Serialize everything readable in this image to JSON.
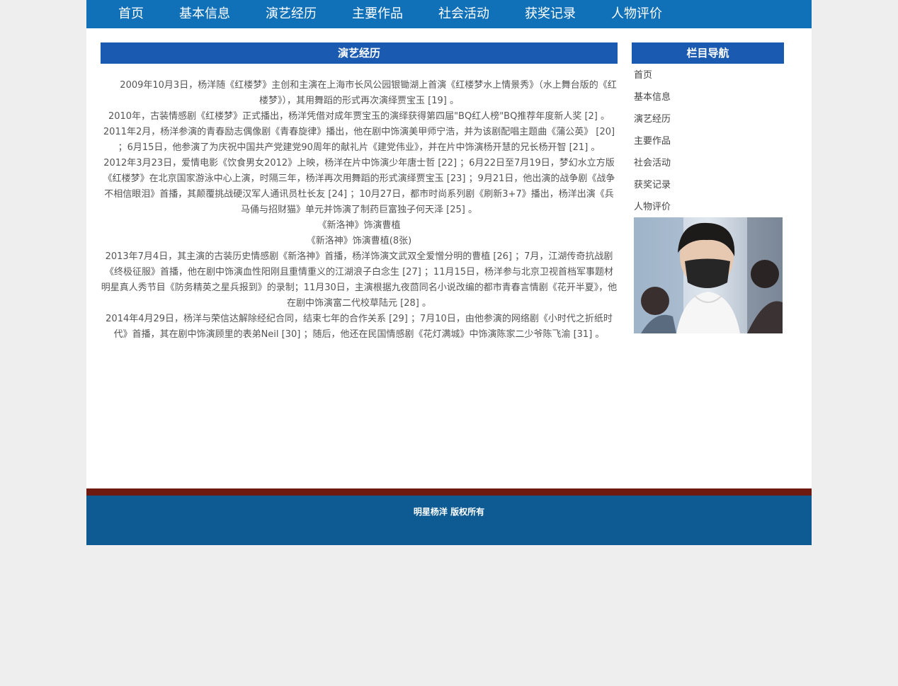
{
  "nav": {
    "items": [
      "首页",
      "基本信息",
      "演艺经历",
      "主要作品",
      "社会活动",
      "获奖记录",
      "人物评价"
    ]
  },
  "main": {
    "title": "演艺经历",
    "paragraphs": [
      "　　2009年10月3日，杨洋随《红楼梦》主创和主演在上海市长风公园银锄湖上首演《红楼梦水上情景秀》（水上舞台版的《红楼梦》），其用舞蹈的形式再次演绎贾宝玉 [19] 。",
      "2010年，古装情感剧《红楼梦》正式播出，杨洋凭借对成年贾宝玉的演绎获得第四届\"BQ红人榜\"BQ推荐年度新人奖 [2] 。",
      "2011年2月，杨洋参演的青春励志偶像剧《青春旋律》播出，他在剧中饰演美甲师宁浩，并为该剧配唱主题曲《蒲公英》 [20] ；6月15日，他参演了为庆祝中国共产党建党90周年的献礼片《建党伟业》，并在片中饰演杨开慧的兄长杨开智 [21] 。",
      "2012年3月23日，爱情电影《饮食男女2012》上映，杨洋在片中饰演少年唐士哲 [22] ；6月22日至7月19日，梦幻水立方版《红楼梦》在北京国家游泳中心上演，时隔三年，杨洋再次用舞蹈的形式演绎贾宝玉 [23] ；9月21日，他出演的战争剧《战争不相信眼泪》首播，其颠覆挑战硬汉军人通讯员杜长友 [24] ；10月27日，都市时尚系列剧《刷新3+7》播出，杨洋出演《兵马俑与招财猫》单元并饰演了制药巨富独子何天泽 [25] 。",
      "《新洛神》饰演曹植",
      "《新洛神》饰演曹植(8张)",
      "2013年7月4日，其主演的古装历史情感剧《新洛神》首播，杨洋饰演文武双全爱憎分明的曹植 [26] ；7月，江湖传奇抗战剧《终极征服》首播，他在剧中饰演血性阳刚且重情重义的江湖浪子白念生 [27] ；11月15日，杨洋参与北京卫视首档军事题材明星真人秀节目《防务精英之星兵报到》的录制；11月30日，主演根据九夜茴同名小说改编的都市青春言情剧《花开半夏》，他在剧中饰演富二代校草陆元 [28] 。",
      "2014年4月29日，杨洋与荣信达解除经纪合同，结束七年的合作关系 [29] ；7月10日，由他参演的网络剧《小时代之折纸时代》首播，其在剧中饰演顾里的表弟Neil [30] ；随后，他还在民国情感剧《花灯满城》中饰演陈家二少爷陈飞渝 [31] 。"
    ]
  },
  "sidebar": {
    "title": "栏目导航",
    "items": [
      "首页",
      "基本信息",
      "演艺经历",
      "主要作品",
      "社会活动",
      "获奖记录",
      "人物评价"
    ]
  },
  "footer": {
    "text": "明星杨洋 版权所有"
  }
}
